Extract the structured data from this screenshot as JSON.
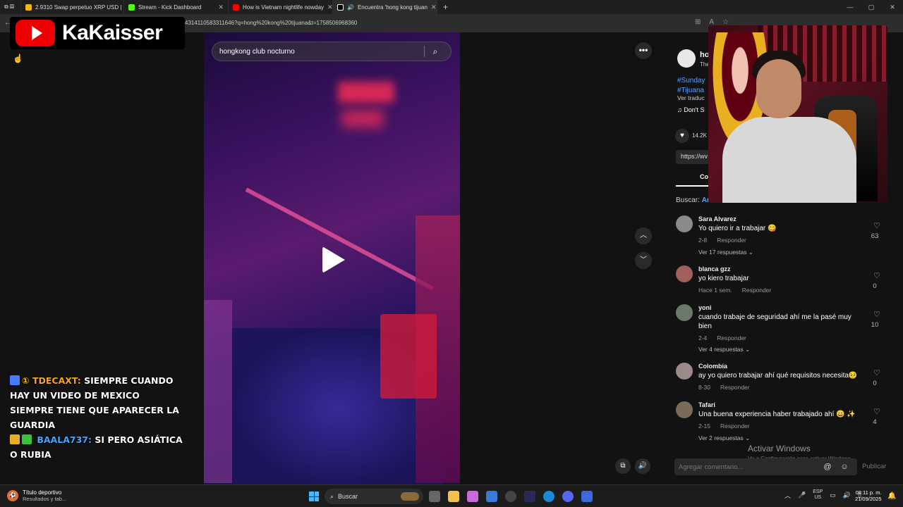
{
  "browser": {
    "tabs": [
      {
        "label": "2.9310 Swap perpetuo XRP USD |",
        "color": "#f0b90b"
      },
      {
        "label": "Stream - Kick Dashboard",
        "color": "#53fc18"
      },
      {
        "label": "How is Vietnam nightlife nowday",
        "color": "#ff0000"
      },
      {
        "label": "Encuentra 'hong kong tijuan",
        "color": "#ffffff"
      }
    ],
    "url": "431411058331164​6?q=hong%20kong%20tijuana&t=1758506968360"
  },
  "stream": {
    "channel_name": "KaKaisser",
    "chat": [
      {
        "user": "TDECAXT:",
        "message": "SIEMPRE CUANDO HAY UN VIDEO DE MEXICO SIEMPRE TIENE QUE APARECER LA GUARDIA",
        "badge": "①"
      },
      {
        "user": "BAALA737:",
        "message": "SI PERO ASIÁTICA O RUBIA"
      }
    ]
  },
  "tiktok": {
    "search_query": "hongkong club nocturno",
    "post": {
      "user": "ho",
      "sub": "The",
      "hashtags": [
        "#Sunday",
        "#Tijuana"
      ],
      "translate": "Ver traduc",
      "music": "♫ Don't S",
      "likes": "14.2K",
      "link": "https://wv",
      "comments_tab": "Co"
    },
    "search_suggest": {
      "label": "Buscar:",
      "query": "Arad"
    },
    "comments": [
      {
        "name": "Sara Alvarez",
        "text": "Yo quiero ir a trabajar 😋",
        "date": "2-8",
        "reply": "Responder",
        "likes": "63",
        "replies": "Ver 17 respuestas ⌄",
        "avatar": "#8a8a8a"
      },
      {
        "name": "blanca gzz",
        "text": "yo kiero trabajar",
        "date": "Hace 1 sem.",
        "reply": "Responder",
        "likes": "0",
        "avatar": "#a0605a"
      },
      {
        "name": "yoni",
        "text": "cuando trabaje de seguridad ahí me la pasé muy bien",
        "date": "2-4",
        "reply": "Responder",
        "likes": "10",
        "replies": "Ver 4 respuestas ⌄",
        "avatar": "#6a7a6a"
      },
      {
        "name": "Colombia",
        "text": "ay yo quiero trabajar ahí qué requisitos necesita🥺",
        "date": "8-30",
        "reply": "Responder",
        "likes": "0",
        "avatar": "#9a8a8a"
      },
      {
        "name": "Tafari",
        "text": "Una buena experiencia haber trabajado ahí 😄 ✨",
        "date": "2-15",
        "reply": "Responder",
        "likes": "4",
        "replies": "Ver 2 respuestas ⌄",
        "avatar": "#7a6a5a"
      }
    ],
    "add_comment_placeholder": "Agregar comentario...",
    "publish_label": "Publicar"
  },
  "windows": {
    "activate_title": "Activar Windows",
    "activate_sub": "Ve a Configuración para activar Windows.",
    "weather_title": "Título deportivo",
    "weather_sub": "Resultados y tab...",
    "search_label": "Buscar",
    "lang_top": "ESP",
    "lang_bottom": "US",
    "time": "08:11 p. m.",
    "date": "21/09/2025"
  }
}
